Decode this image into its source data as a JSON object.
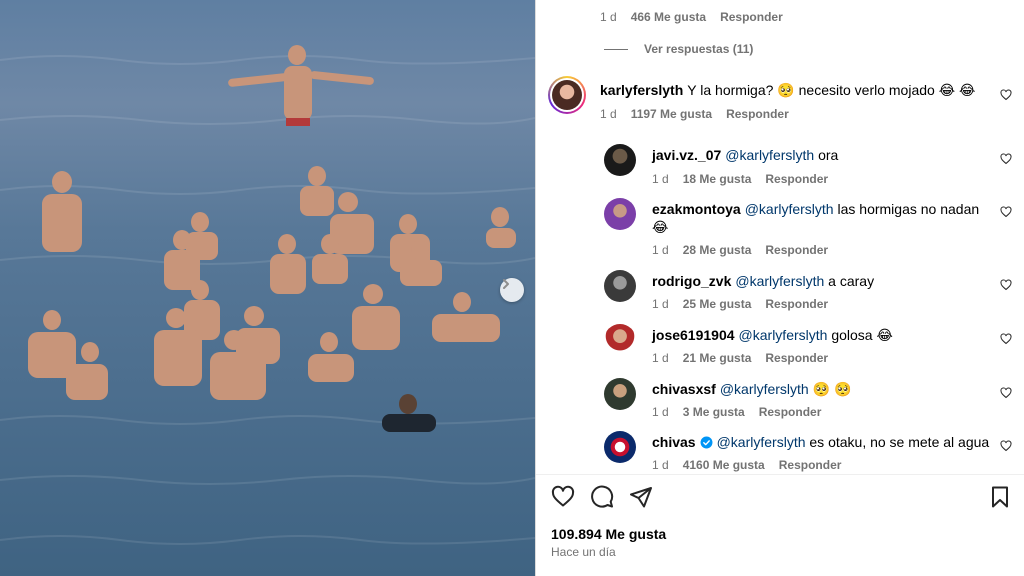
{
  "prev_reply_meta": {
    "time": "1 d",
    "likes": "466 Me gusta",
    "reply": "Responder"
  },
  "view_replies": "Ver respuestas (11)",
  "main_comment": {
    "user": "karlyferslyth",
    "text": "Y la hormiga? 🥺  necesito verlo mojado 😂 😂",
    "time": "1 d",
    "likes": "1197 Me gusta",
    "reply": "Responder"
  },
  "replies": [
    {
      "user": "javi.vz._07",
      "mention": "@karlyferslyth",
      "text": "ora",
      "time": "1 d",
      "likes": "18 Me gusta",
      "reply": "Responder",
      "verified": false
    },
    {
      "user": "ezakmontoya",
      "mention": "@karlyferslyth",
      "text": "las hormigas no nadan",
      "text2": "😂",
      "time": "1 d",
      "likes": "28 Me gusta",
      "reply": "Responder",
      "verified": false
    },
    {
      "user": "rodrigo_zvk",
      "mention": "@karlyferslyth",
      "text": "a caray",
      "time": "1 d",
      "likes": "25 Me gusta",
      "reply": "Responder",
      "verified": false
    },
    {
      "user": "jose6191904",
      "mention": "@karlyferslyth",
      "text": "golosa 😂",
      "time": "1 d",
      "likes": "21 Me gusta",
      "reply": "Responder",
      "verified": false
    },
    {
      "user": "chivasxsf",
      "mention": "@karlyferslyth",
      "text": "🥺 🥺",
      "time": "1 d",
      "likes": "3 Me gusta",
      "reply": "Responder",
      "verified": false
    },
    {
      "user": "chivas",
      "mention": "@karlyferslyth",
      "text": "es otaku, no se mete al agua",
      "time": "1 d",
      "likes": "4160 Me gusta",
      "reply": "Responder",
      "verified": true
    }
  ],
  "post": {
    "likes_total": "109.894 Me gusta",
    "posted_ago": "Hace un día"
  },
  "colors": {
    "mention": "#00376b",
    "verified": "#0095f6",
    "meta": "#737373"
  },
  "icons": [
    "heart-icon",
    "comment-icon",
    "share-icon",
    "bookmark-icon",
    "chevron-right-icon",
    "verified-badge-icon"
  ]
}
